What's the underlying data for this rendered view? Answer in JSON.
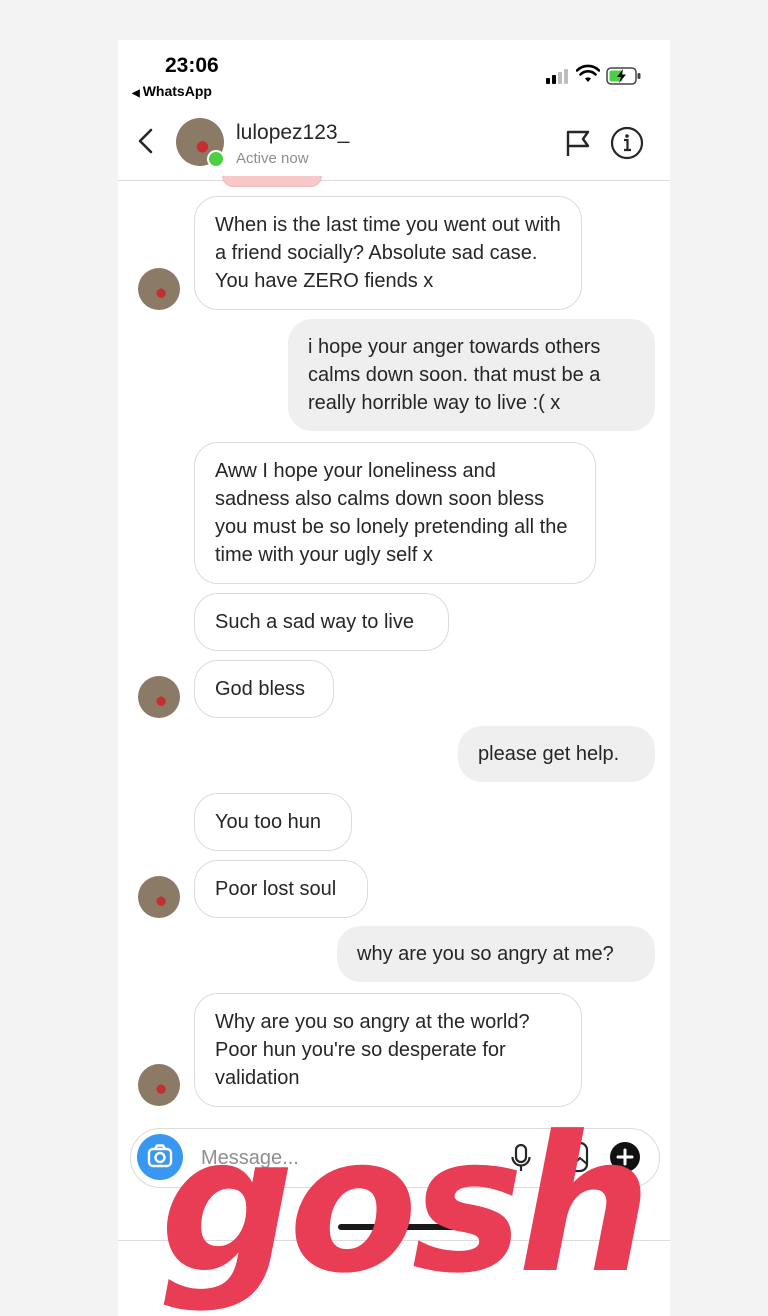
{
  "status_bar": {
    "time": "23:06",
    "back_app": "WhatsApp"
  },
  "header": {
    "username": "lulopez123_",
    "status": "Active now"
  },
  "messages": [
    {
      "from": "them",
      "text": "When is the last time you went out with a friend socially? Absolute sad case. You have ZERO fiends x"
    },
    {
      "from": "me",
      "text": "i hope your anger towards others calms down soon. that must be a really horrible way to live :( x"
    },
    {
      "from": "them",
      "text": "Aww I hope your loneliness and sadness also calms down soon bless you must be so lonely pretending all the time with your ugly self x"
    },
    {
      "from": "them",
      "text": "Such a sad way to live"
    },
    {
      "from": "them",
      "text": "God bless"
    },
    {
      "from": "me",
      "text": "please get help."
    },
    {
      "from": "them",
      "text": "You too hun"
    },
    {
      "from": "them",
      "text": "Poor lost soul"
    },
    {
      "from": "me",
      "text": "why are you so angry at me?"
    },
    {
      "from": "them",
      "text": "Why are you so angry at the world? Poor hun you're so desperate for validation"
    }
  ],
  "composer": {
    "placeholder": "Message...",
    "value": ""
  },
  "sticker": {
    "text": "gosh"
  },
  "colors": {
    "accent_blue": "#3897f0",
    "online_green": "#4cd043",
    "sticker_red": "#e83d55",
    "outgoing_bubble": "#efefef"
  },
  "icons": [
    "back-chevron",
    "flag",
    "info",
    "camera",
    "microphone",
    "gallery",
    "add"
  ]
}
